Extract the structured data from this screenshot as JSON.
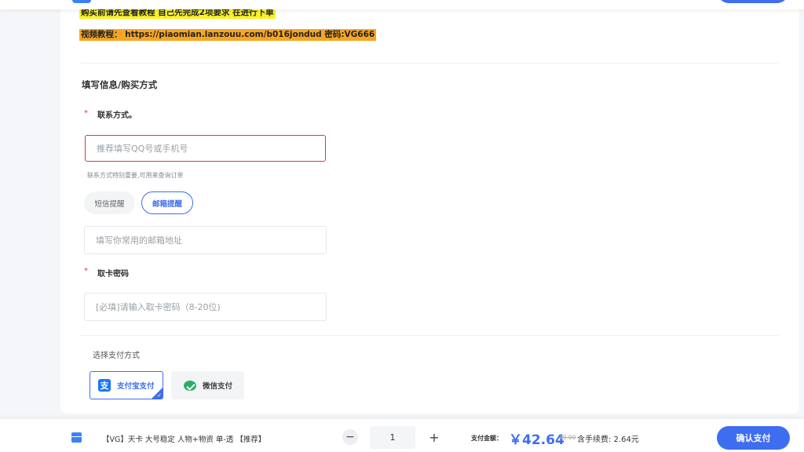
{
  "notices": {
    "line1": "购买前请先查看教程  自己先完成2项要求 在进行下单",
    "line2": "视频教程： https://piaomian.lanzouu.com/b016jondud 密码:VG666"
  },
  "form": {
    "section_title": "填写信息/购买方式",
    "contact": {
      "label": "联系方式。",
      "required_mark": "*",
      "placeholder": "推荐填写QQ号或手机号",
      "hint": "联系方式特别重要,可用来查询订单"
    },
    "reminder": {
      "sms_label": "短信提醒",
      "email_label": "邮箱提醒",
      "selected": "email",
      "email_placeholder": "填写你常用的邮箱地址"
    },
    "card_password": {
      "label": "取卡密码",
      "required_mark": "*",
      "placeholder": "[必填]请输入取卡密码（8-20位)"
    }
  },
  "payment": {
    "title": "选择支付方式",
    "alipay_label": "支付宝支付",
    "alipay_glyph": "支",
    "wechat_label": "微信支付",
    "selected": "alipay",
    "accent_color": "#3f6df0"
  },
  "bottom_bar": {
    "product_name": "【VG】天卡 大号稳定 人物+物资 单-透 【推荐】",
    "quantity": "1",
    "minus_label": "−",
    "plus_label": "+",
    "amount_label": "支付金额：",
    "price": "￥42.64",
    "old_price": "40.00",
    "fee_text": "含手续费: 2.64元",
    "confirm_label": "确认支付"
  }
}
